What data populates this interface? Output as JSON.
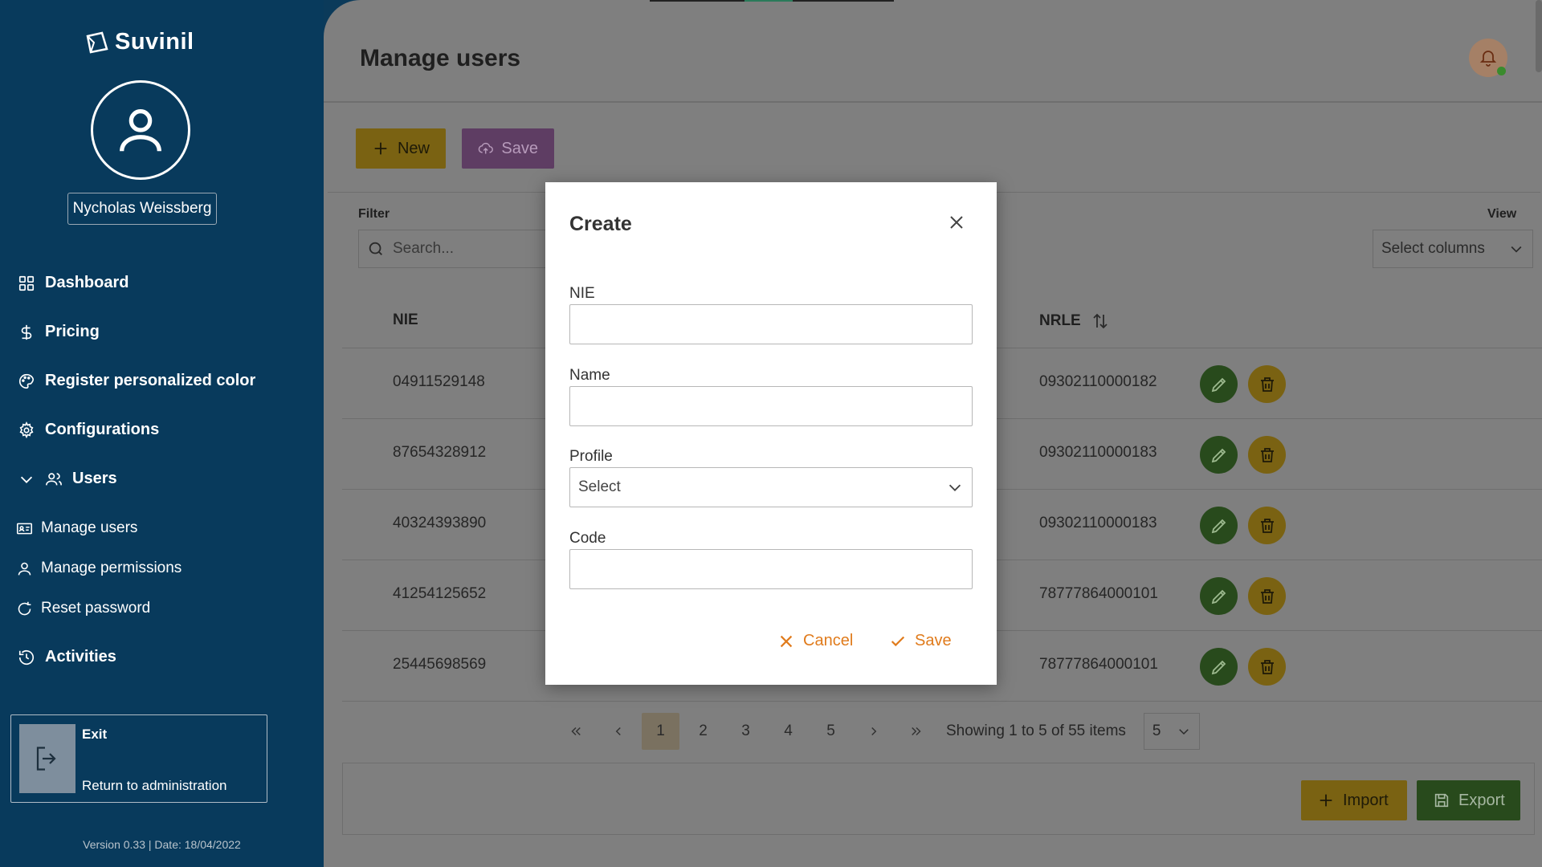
{
  "app": {
    "brand": "Suvinil",
    "user_name": "Nycholas Weissberg",
    "version": "Version 0.33 | Date: 18/04/2022"
  },
  "sidebar": {
    "items": [
      {
        "label": "Dashboard",
        "icon": "grid-icon"
      },
      {
        "label": "Pricing",
        "icon": "dollar-icon"
      },
      {
        "label": "Register personalized color",
        "icon": "palette-icon"
      },
      {
        "label": "Configurations",
        "icon": "gear-icon"
      },
      {
        "label": "Users",
        "icon": "users-icon",
        "expanded": true
      }
    ],
    "sub_items": [
      {
        "label": "Manage users",
        "icon": "id-card-icon"
      },
      {
        "label": "Manage permissions",
        "icon": "user-icon"
      },
      {
        "label": "Reset password",
        "icon": "refresh-icon"
      }
    ],
    "activities": {
      "label": "Activities",
      "icon": "history-icon"
    },
    "exit": {
      "title": "Exit",
      "subtitle": "Return to administration"
    }
  },
  "header": {
    "title": "Manage users"
  },
  "toolbar": {
    "new_label": "New",
    "save_label": "Save"
  },
  "filter": {
    "label": "Filter",
    "search_placeholder": "Search..."
  },
  "view": {
    "label": "View",
    "select_columns": "Select columns"
  },
  "table": {
    "columns": [
      "NIE",
      "NRLE"
    ],
    "rows": [
      {
        "nie": "04911529148",
        "nrle": "09302110000182"
      },
      {
        "nie": "87654328912",
        "nrle": "09302110000183"
      },
      {
        "nie": "40324393890",
        "nrle": "09302110000183"
      },
      {
        "nie": "41254125652",
        "nrle": "78777864000101"
      },
      {
        "nie": "25445698569",
        "nrle": "78777864000101"
      }
    ]
  },
  "pagination": {
    "pages": [
      "1",
      "2",
      "3",
      "4",
      "5"
    ],
    "current_page": "1",
    "info": "Showing 1 to 5 of 55 items",
    "page_size": "5"
  },
  "footer": {
    "import_label": "Import",
    "export_label": "Export"
  },
  "modal": {
    "title": "Create",
    "fields": {
      "nie_label": "NIE",
      "nie_value": "",
      "name_label": "Name",
      "name_value": "",
      "profile_label": "Profile",
      "profile_value": "Select",
      "code_label": "Code",
      "code_value": ""
    },
    "cancel_label": "Cancel",
    "save_label": "Save"
  },
  "colors": {
    "sidebar_bg": "#083a5c",
    "accent_orange": "#e07b1c",
    "btn_new": "#f0c020",
    "btn_save": "#b87ac0",
    "edit_green": "#4f8a37",
    "delete_yellow": "#f0c020"
  }
}
